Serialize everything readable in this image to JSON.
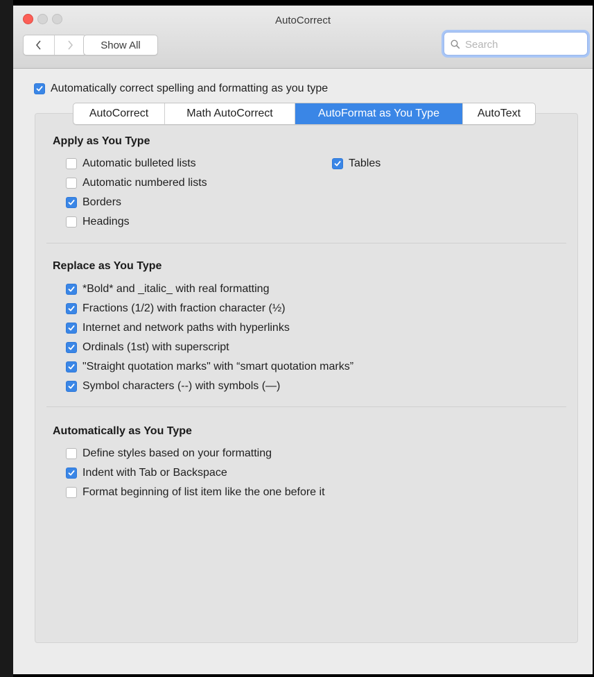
{
  "window": {
    "title": "AutoCorrect"
  },
  "toolbar": {
    "show_all_label": "Show All"
  },
  "search": {
    "placeholder": "Search",
    "value": ""
  },
  "master": {
    "label": "Automatically correct spelling and formatting as you type",
    "checked": true
  },
  "tabs": [
    {
      "label": "AutoCorrect",
      "active": false
    },
    {
      "label": "Math AutoCorrect",
      "active": false
    },
    {
      "label": "AutoFormat as You Type",
      "active": true
    },
    {
      "label": "AutoText",
      "active": false
    }
  ],
  "apply": {
    "heading": "Apply as You Type",
    "items": [
      {
        "label": "Automatic bulleted lists",
        "checked": false
      },
      {
        "label": "Automatic numbered lists",
        "checked": false
      },
      {
        "label": "Borders",
        "checked": true
      },
      {
        "label": "Headings",
        "checked": false
      },
      {
        "label": "Tables",
        "checked": true
      }
    ]
  },
  "replace": {
    "heading": "Replace as You Type",
    "items": [
      {
        "label": "*Bold* and _italic_ with real formatting",
        "checked": true
      },
      {
        "label": "Fractions (1/2) with fraction character (½)",
        "checked": true
      },
      {
        "label": "Internet and network paths with hyperlinks",
        "checked": true
      },
      {
        "label": "Ordinals (1st) with superscript",
        "checked": true
      },
      {
        "label": "\"Straight quotation marks\" with “smart quotation marks”",
        "checked": true
      },
      {
        "label": "Symbol characters (--) with symbols (—)",
        "checked": true
      }
    ]
  },
  "auto": {
    "heading": "Automatically as You Type",
    "items": [
      {
        "label": "Define styles based on your formatting",
        "checked": false
      },
      {
        "label": "Indent with Tab or Backspace",
        "checked": true
      },
      {
        "label": "Format beginning of list item like the one before it",
        "checked": false
      }
    ]
  },
  "colors": {
    "accent": "#3a86e6",
    "close": "#fc5f57"
  }
}
